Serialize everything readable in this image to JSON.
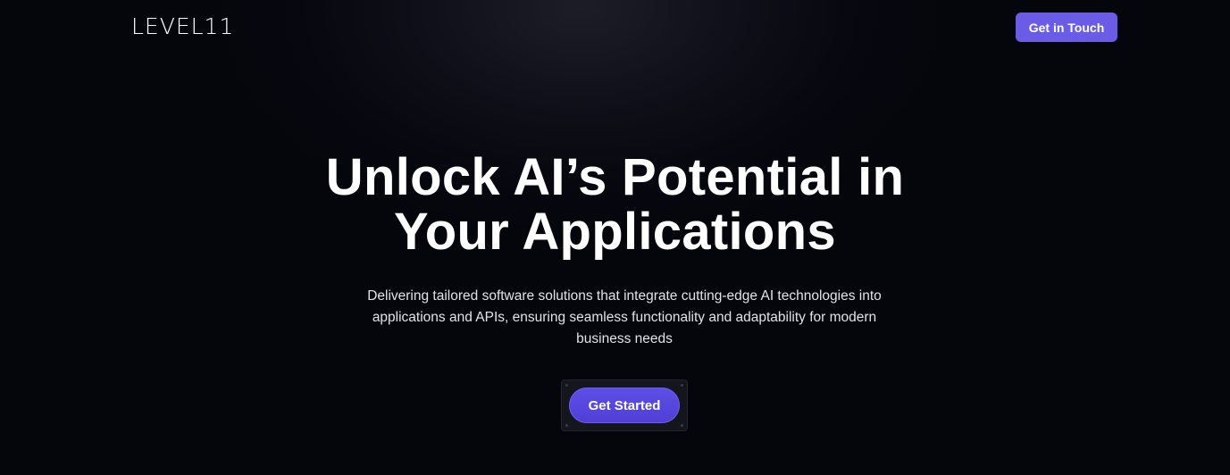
{
  "header": {
    "logo_text": "LEVEL11",
    "cta_label": "Get in Touch"
  },
  "hero": {
    "title_line1": "Unlock AI’s Potential in",
    "title_line2": "Your Applications",
    "subtitle": "Delivering tailored software solutions that integrate cutting-edge AI technologies into applications and APIs, ensuring seamless functionality and adaptability for modern business needs",
    "cta_label": "Get Started"
  },
  "colors": {
    "background": "#05050c",
    "accent": "#6b5ce7",
    "cta": "#5a4be3",
    "text": "#ffffff"
  }
}
